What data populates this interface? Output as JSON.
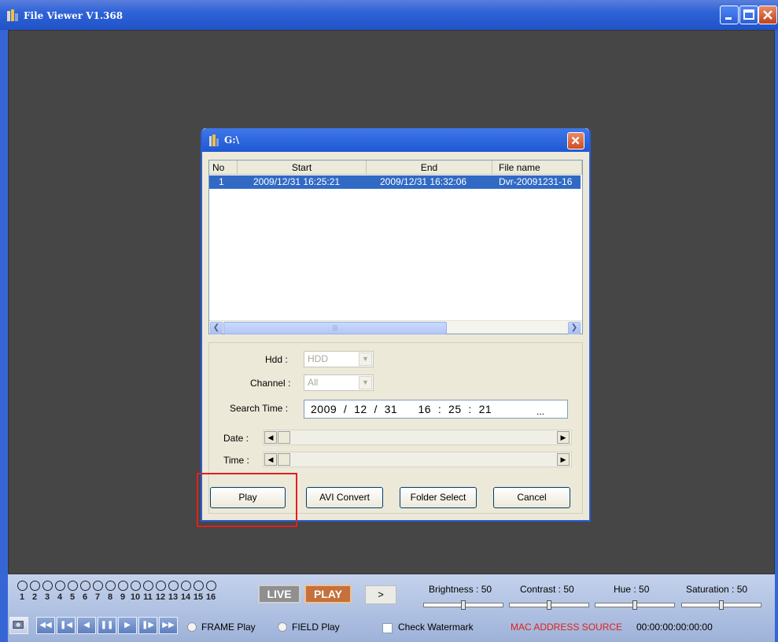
{
  "window": {
    "title": "File Viewer V1.368",
    "icon": "film-building-icon"
  },
  "dialog": {
    "title": "G:\\",
    "list": {
      "columns": [
        "No",
        "Start",
        "End",
        "File name"
      ],
      "rows": [
        {
          "no": "1",
          "start": "2009/12/31  16:25:21",
          "end": "2009/12/31  16:32:06",
          "file": "Dvr-20091231-16"
        }
      ],
      "scroll_mid_glyph": "|||"
    },
    "hdd": {
      "label": "Hdd :",
      "value": "HDD"
    },
    "channel": {
      "label": "Channel :",
      "value": "All"
    },
    "search_time": {
      "label": "Search Time :",
      "value": "2009  /  12  /  31      16  :  25  :  21",
      "more": "..."
    },
    "date_label": "Date :",
    "time_label": "Time :",
    "buttons": {
      "play": "Play",
      "avi": "AVI Convert",
      "folder": "Folder Select",
      "cancel": "Cancel"
    }
  },
  "bottom": {
    "channels": [
      "1",
      "2",
      "3",
      "4",
      "5",
      "6",
      "7",
      "8",
      "9",
      "10",
      "11",
      "12",
      "13",
      "14",
      "15",
      "16"
    ],
    "live": "LIVE",
    "play": "PLAY",
    "next": ">",
    "brightness": "Brightness : 50",
    "contrast": "Contrast : 50",
    "hue": "Hue : 50",
    "saturation": "Saturation : 50",
    "slider_levels_percent": [
      50,
      50,
      50,
      50
    ],
    "frame_play": "FRAME Play",
    "field_play": "FIELD Play",
    "check_watermark": "Check Watermark",
    "mac_label": "MAC ADDRESS SOURCE",
    "mac_value": "00:00:00:00:00:00",
    "accent_red": "#e0201c"
  }
}
